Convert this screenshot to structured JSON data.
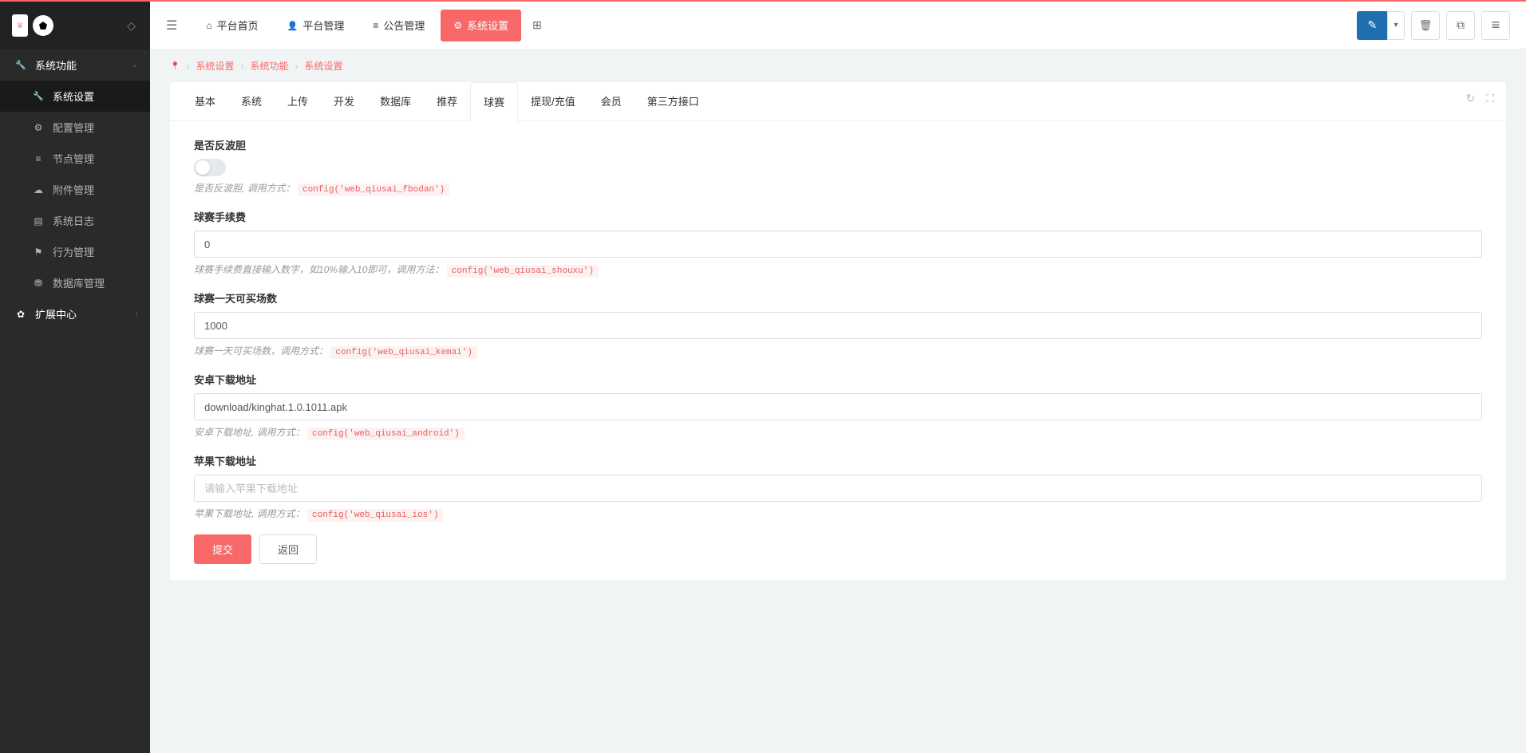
{
  "sidebar": {
    "sections": [
      {
        "label": "系统功能",
        "items": [
          {
            "label": "系统设置"
          },
          {
            "label": "配置管理"
          },
          {
            "label": "节点管理"
          },
          {
            "label": "附件管理"
          },
          {
            "label": "系统日志"
          },
          {
            "label": "行为管理"
          },
          {
            "label": "数据库管理"
          }
        ]
      },
      {
        "label": "扩展中心"
      }
    ]
  },
  "header": {
    "nav": [
      {
        "label": "平台首页"
      },
      {
        "label": "平台管理"
      },
      {
        "label": "公告管理"
      },
      {
        "label": "系统设置"
      }
    ]
  },
  "breadcrumb": {
    "items": [
      "系统设置",
      "系统功能",
      "系统设置"
    ]
  },
  "tabs": [
    "基本",
    "系统",
    "上传",
    "开发",
    "数据库",
    "推荐",
    "球赛",
    "提现/充值",
    "会员",
    "第三方接口"
  ],
  "form": {
    "fbodan": {
      "label": "是否反波胆",
      "help_prefix": "是否反波胆, 调用方式：",
      "help_code": "config('web_qiusai_fbodan')"
    },
    "shouxu": {
      "label": "球赛手续费",
      "value": "0",
      "help_prefix": "球赛手续费直接输入数字，如10%输入10即可，调用方法：",
      "help_code": "config('web_qiusai_shouxu')"
    },
    "kemai": {
      "label": "球赛一天可买场数",
      "value": "1000",
      "help_prefix": "球赛一天可买场数，调用方式：",
      "help_code": "config('web_qiusai_kemai')"
    },
    "android": {
      "label": "安卓下载地址",
      "value": "download/kinghat.1.0.1011.apk",
      "help_prefix": "安卓下载地址, 调用方式：",
      "help_code": "config('web_qiusai_android')"
    },
    "ios": {
      "label": "苹果下载地址",
      "placeholder": "请输入苹果下载地址",
      "help_prefix": "苹果下载地址, 调用方式：",
      "help_code": "config('web_qiusai_ios')"
    },
    "submit": "提交",
    "back": "返回"
  }
}
